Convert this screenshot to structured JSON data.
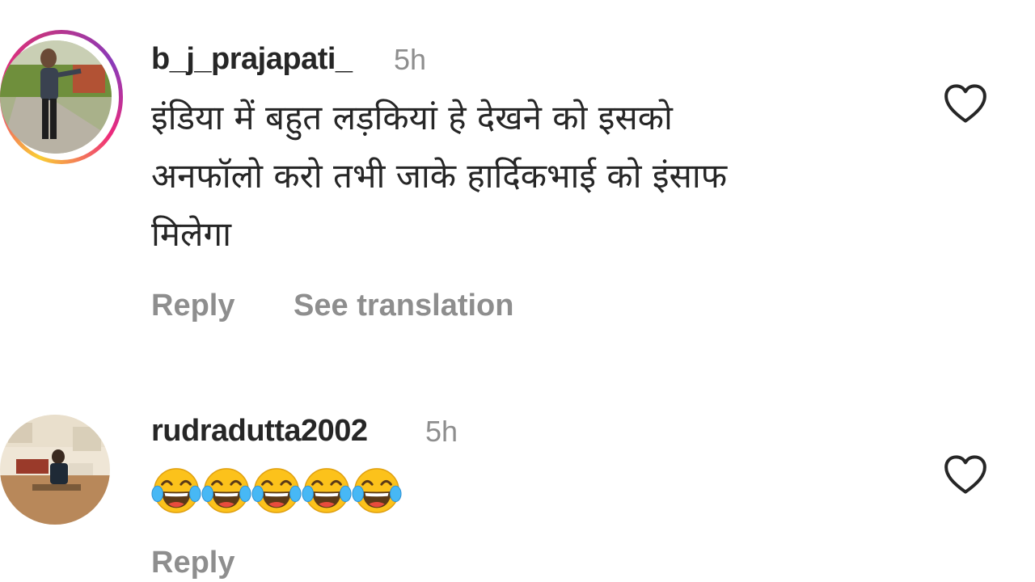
{
  "comments": [
    {
      "username": "b_j_prajapati_",
      "time": "5h",
      "lines": [
        "इंडिया में बहुत लड़कियां हे देखने को इसको",
        "अनफॉलो करो तभी जाके हार्दिकभाई को इंसाफ",
        "मिलेगा"
      ],
      "actions": {
        "reply": "Reply",
        "translate": "See translation"
      },
      "like_icon": "heart-outline-icon",
      "has_story_ring": true
    },
    {
      "username": "rudradutta2002",
      "time": "5h",
      "emoji": [
        "😂",
        "😂",
        "😂",
        "😂",
        "😂"
      ],
      "actions": {
        "reply": "Reply"
      },
      "like_icon": "heart-outline-icon",
      "has_story_ring": false
    }
  ],
  "colors": {
    "text": "#262626",
    "secondary": "#8e8e8e",
    "story_ring": [
      "#f9ce34",
      "#ee2a7b",
      "#8a3ab9"
    ]
  }
}
